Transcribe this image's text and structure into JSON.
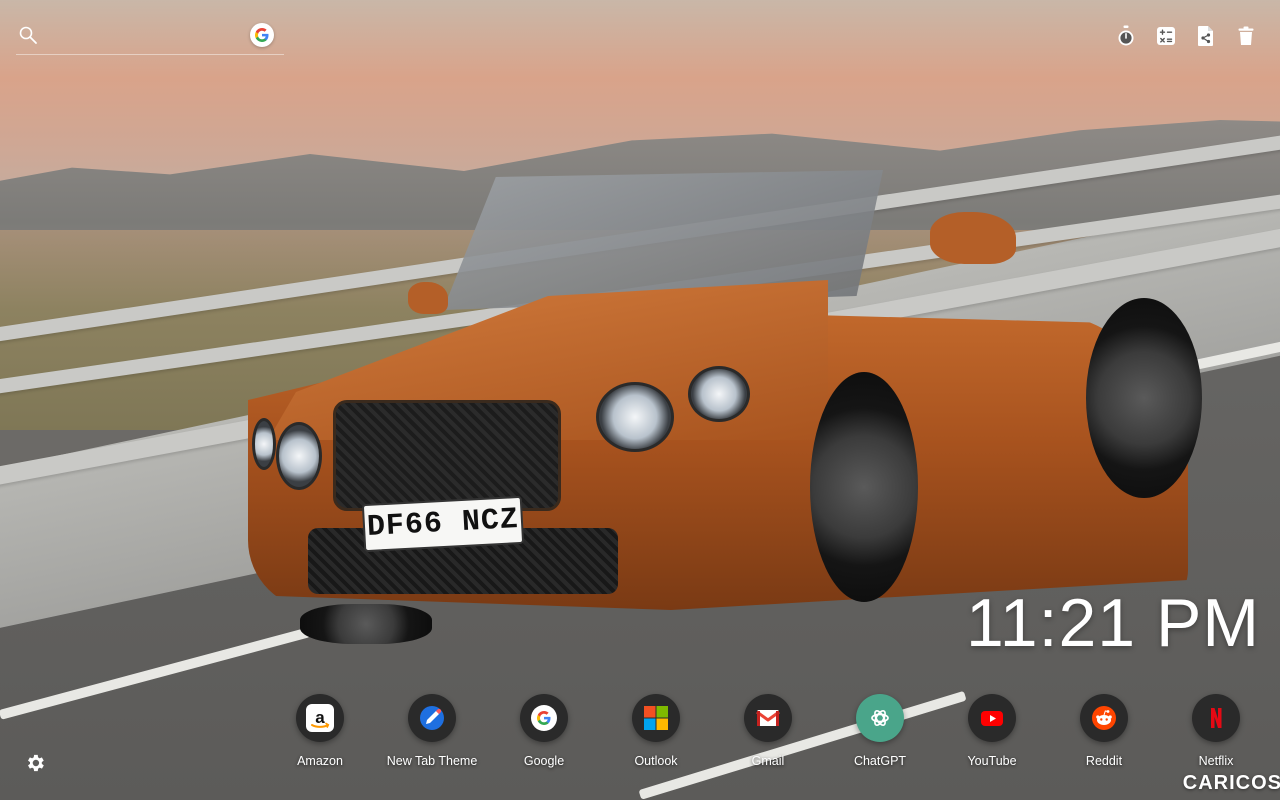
{
  "search": {
    "placeholder": "",
    "engine_icon": "google-icon"
  },
  "toolbar": [
    {
      "icon": "stopwatch-icon"
    },
    {
      "icon": "calculator-icon"
    },
    {
      "icon": "file-share-icon"
    },
    {
      "icon": "trash-icon"
    }
  ],
  "clock": {
    "time": "11:21 PM"
  },
  "background": {
    "plate": "DF66 NCZ",
    "watermark": "CARICOS"
  },
  "shortcuts": [
    {
      "label": "Amazon",
      "icon": "amazon-icon"
    },
    {
      "label": "New Tab Theme",
      "icon": "new-tab-theme-icon"
    },
    {
      "label": "Google",
      "icon": "google-icon"
    },
    {
      "label": "Outlook",
      "icon": "microsoft-icon"
    },
    {
      "label": "Gmail",
      "icon": "gmail-icon"
    },
    {
      "label": "ChatGPT",
      "icon": "chatgpt-icon"
    },
    {
      "label": "YouTube",
      "icon": "youtube-icon"
    },
    {
      "label": "Reddit",
      "icon": "reddit-icon"
    },
    {
      "label": "Netflix",
      "icon": "netflix-icon"
    }
  ],
  "settings": {
    "icon": "gear-icon"
  },
  "colors": {
    "dock_bg": "#2a2a2a",
    "text": "#ffffff",
    "car": "#b45f28"
  }
}
